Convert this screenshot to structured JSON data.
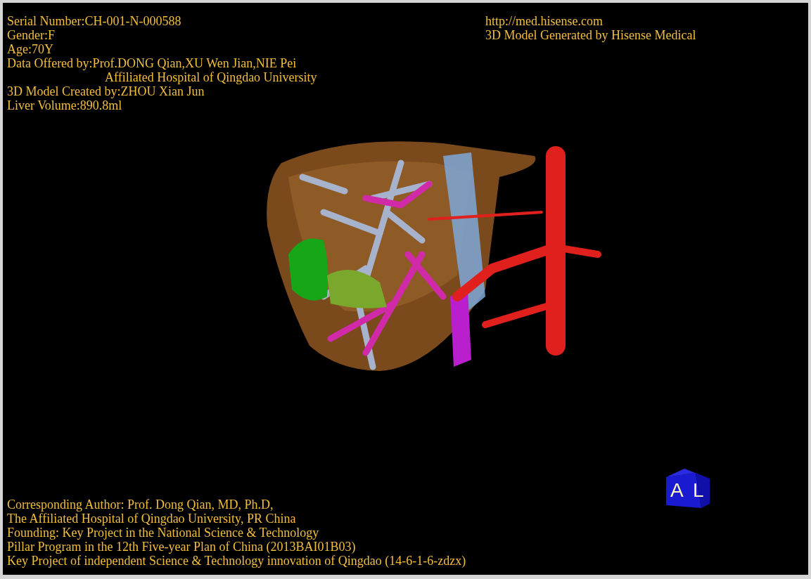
{
  "top_left_info": [
    {
      "kind": "line",
      "text": "Serial Number:CH-001-N-000588"
    },
    {
      "kind": "line",
      "text": "Gender:F"
    },
    {
      "kind": "line",
      "text": "Age:70Y"
    },
    {
      "kind": "line",
      "text": "Data Offered by:Prof.DONG Qian,XU Wen Jian,NIE Pei"
    },
    {
      "kind": "continuation",
      "text": "Affiliated Hospital of Qingdao University"
    },
    {
      "kind": "line",
      "text": "3D Model Created by:ZHOU Xian Jun"
    },
    {
      "kind": "line",
      "text": "Liver Volume:890.8ml"
    }
  ],
  "top_right_info": [
    "http://med.hisense.com",
    "3D Model Generated by Hisense Medical"
  ],
  "orientation_cube": {
    "front_label": "A",
    "side_label": "L"
  },
  "bottom_info": [
    "Corresponding Author: Prof. Dong Qian, MD, Ph.D,",
    "The Affiliated Hospital of Qingdao University, PR China",
    "Founding: Key Project in the National Science & Technology",
    "Pillar Program in the 12th Five-year Plan of China (2013BAI01B03)",
    "Key Project of independent Science & Technology innovation of Qingdao (14-6-1-6-zdzx)"
  ]
}
